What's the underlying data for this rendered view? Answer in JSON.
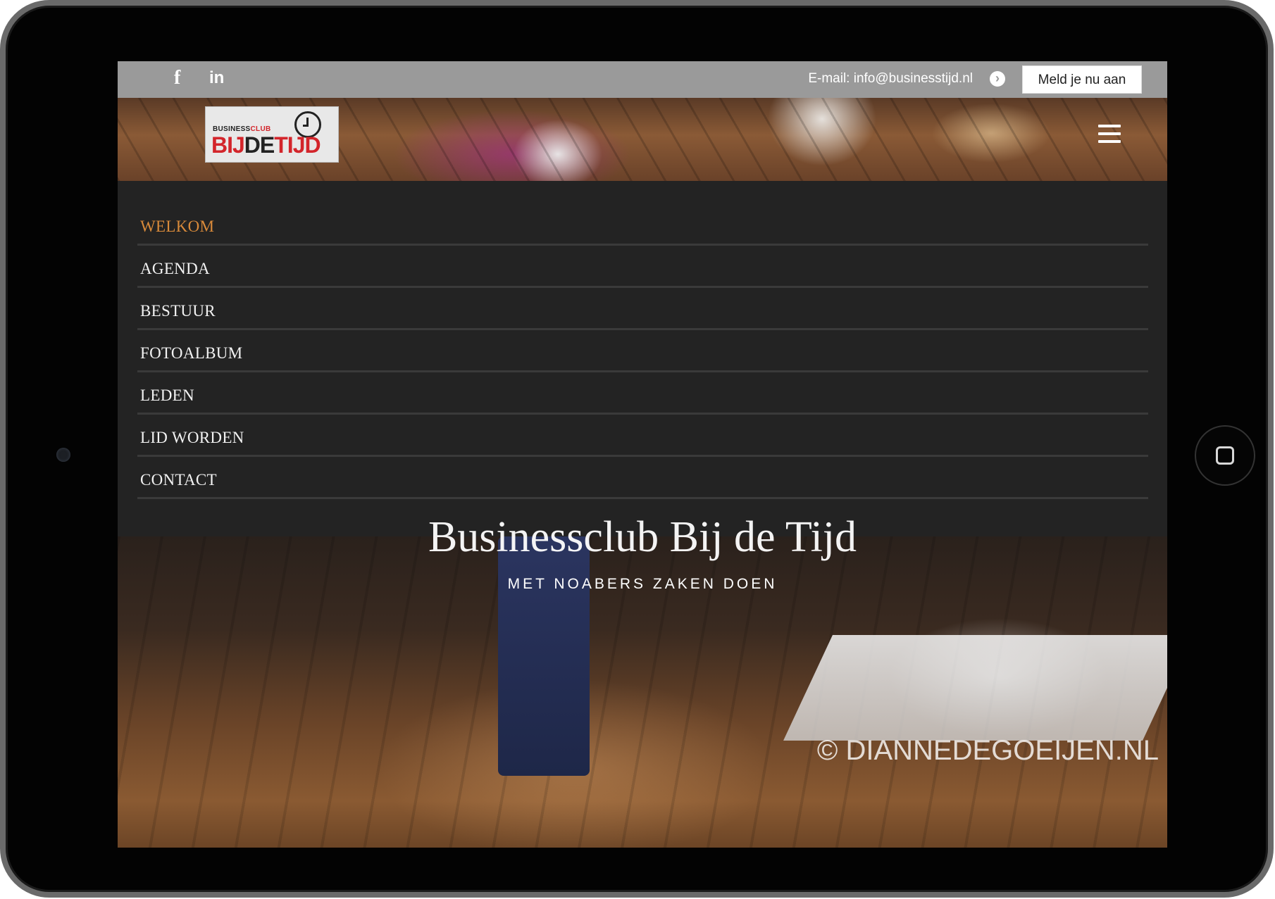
{
  "topbar": {
    "facebook_glyph": "f",
    "linkedin_glyph": "in",
    "email_text": "E-mail: info@businesstijd.nl",
    "arrow_glyph": "›",
    "cta_label": "Meld je nu aan"
  },
  "logo": {
    "line1_a": "BUSINESS",
    "line1_b": "CLUB",
    "line2_a": "BIJ",
    "line2_b": "DE",
    "line2_c": "TIJD"
  },
  "menu": {
    "items": [
      "WELKOM",
      "AGENDA",
      "BESTUUR",
      "FOTOALBUM",
      "LEDEN",
      "LID WORDEN",
      "CONTACT"
    ],
    "active_index": 0,
    "active_color": "#d98a3a"
  },
  "hero": {
    "title": "Businessclub Bij de Tijd",
    "subtitle": "MET NOABERS ZAKEN DOEN",
    "watermark": "© DIANNEDEGOEIJEN.NL"
  },
  "icons": {
    "facebook": "facebook-icon",
    "linkedin": "linkedin-icon",
    "arrow": "arrow-right-circle-icon",
    "menu": "hamburger-menu-icon",
    "clock": "clock-icon"
  }
}
